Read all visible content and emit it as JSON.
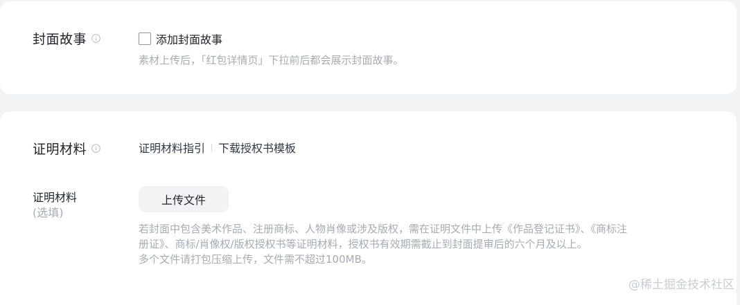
{
  "cover_story": {
    "title": "封面故事",
    "checkbox_label": "添加封面故事",
    "checked": false,
    "hint": "素材上传后，「红包详情页」下拉前后都会展示封面故事。"
  },
  "proof": {
    "title": "证明材料",
    "links": [
      "证明材料指引",
      "下载授权书模板"
    ],
    "field_label": "证明材料",
    "field_sublabel": "(选填)",
    "upload_button": "上传文件",
    "hint_lines": [
      "若封面中包含美术作品、注册商标、人物肖像或涉及版权，需在证明文件中上传《作品登记证书》、《商标注",
      "册证》、商标/肖像权/版权授权书等证明材料，授权书有效期需截止到封面提审后的六个月及以上。",
      "多个文件请打包压缩上传，文件需不超过100MB。"
    ]
  },
  "watermark": "@稀土掘金技术社区",
  "icons": {
    "info": "info-circle-icon"
  },
  "colors": {
    "background": "#f2f3f5",
    "card": "#ffffff",
    "hint": "#a8abb2",
    "text": "#1f2329"
  }
}
